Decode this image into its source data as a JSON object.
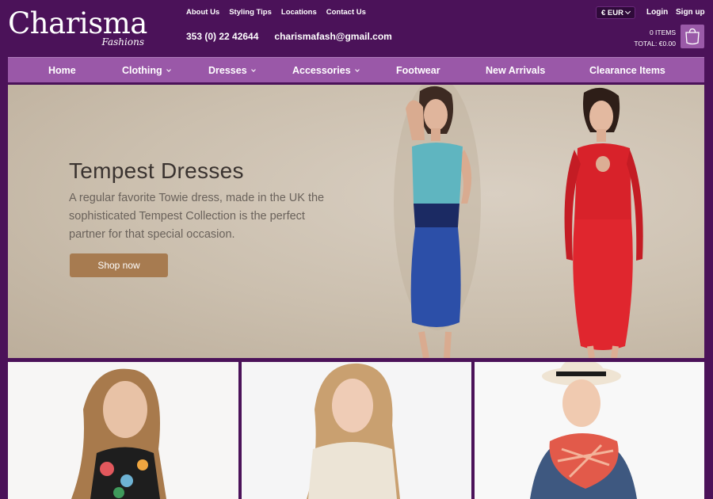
{
  "brand": {
    "name": "Charisma",
    "tagline": "Fashions"
  },
  "top_links": [
    "About Us",
    "Styling Tips",
    "Locations",
    "Contact Us"
  ],
  "contact": {
    "phone": "353 (0) 22 42644",
    "email": "charismafash@gmail.com"
  },
  "account": {
    "currency": "€ EUR",
    "login": "Login",
    "signup": "Sign up"
  },
  "cart": {
    "items": "0 ITEMS",
    "total": "TOTAL: €0.00"
  },
  "nav": [
    {
      "label": "Home",
      "dropdown": false
    },
    {
      "label": "Clothing",
      "dropdown": true
    },
    {
      "label": "Dresses",
      "dropdown": true
    },
    {
      "label": "Accessories",
      "dropdown": true
    },
    {
      "label": "Footwear",
      "dropdown": false
    },
    {
      "label": "New Arrivals",
      "dropdown": false
    },
    {
      "label": "Clearance Items",
      "dropdown": false
    }
  ],
  "hero": {
    "title": "Tempest Dresses",
    "description": "A regular favorite Towie dress, made in the UK the sophisticated Tempest Collection is the perfect partner for that special occasion.",
    "button": "Shop now"
  },
  "colors": {
    "background": "#4b1259",
    "nav": "#9a58a8",
    "button": "#a77b50"
  }
}
